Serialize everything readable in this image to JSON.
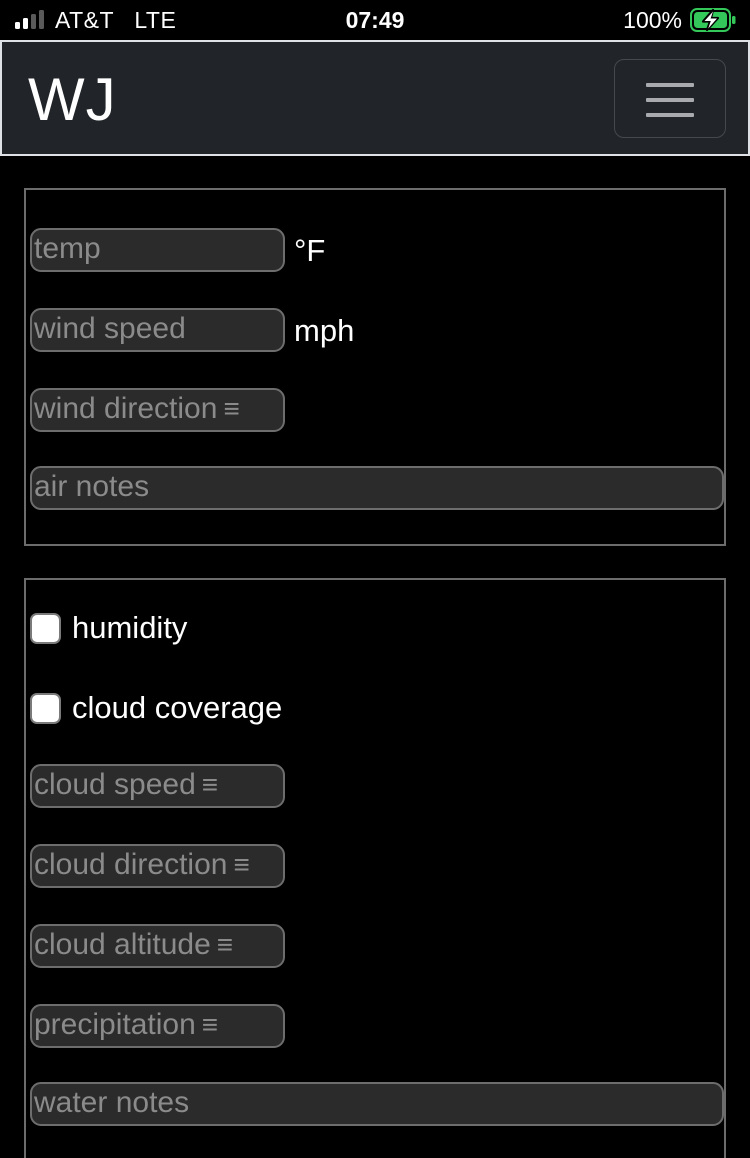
{
  "status_bar": {
    "carrier": "AT&T   LTE",
    "time": "07:49",
    "battery_percent": "100%",
    "battery_level": 1.0,
    "signal_bars_filled": 2,
    "signal_bars_total": 4,
    "battery_color": "#34c759"
  },
  "navbar": {
    "brand": "WJ",
    "menu_icon": "hamburger-icon"
  },
  "air_card": {
    "temp": {
      "placeholder": "temp",
      "unit": "°F"
    },
    "wind_speed": {
      "placeholder": "wind speed",
      "unit": "mph"
    },
    "wind_direction": {
      "placeholder": "wind direction",
      "menu_glyph": "≡"
    },
    "air_notes": {
      "placeholder": "air notes"
    }
  },
  "water_card": {
    "humidity": {
      "label": "humidity",
      "checked": false
    },
    "cloud_coverage": {
      "label": "cloud coverage",
      "checked": false
    },
    "cloud_speed": {
      "placeholder": "cloud speed",
      "menu_glyph": "≡"
    },
    "cloud_direction": {
      "placeholder": "cloud direction",
      "menu_glyph": "≡"
    },
    "cloud_altitude": {
      "placeholder": "cloud altitude",
      "menu_glyph": "≡"
    },
    "precipitation": {
      "placeholder": "precipitation",
      "menu_glyph": "≡"
    },
    "water_notes": {
      "placeholder": "water notes"
    }
  }
}
